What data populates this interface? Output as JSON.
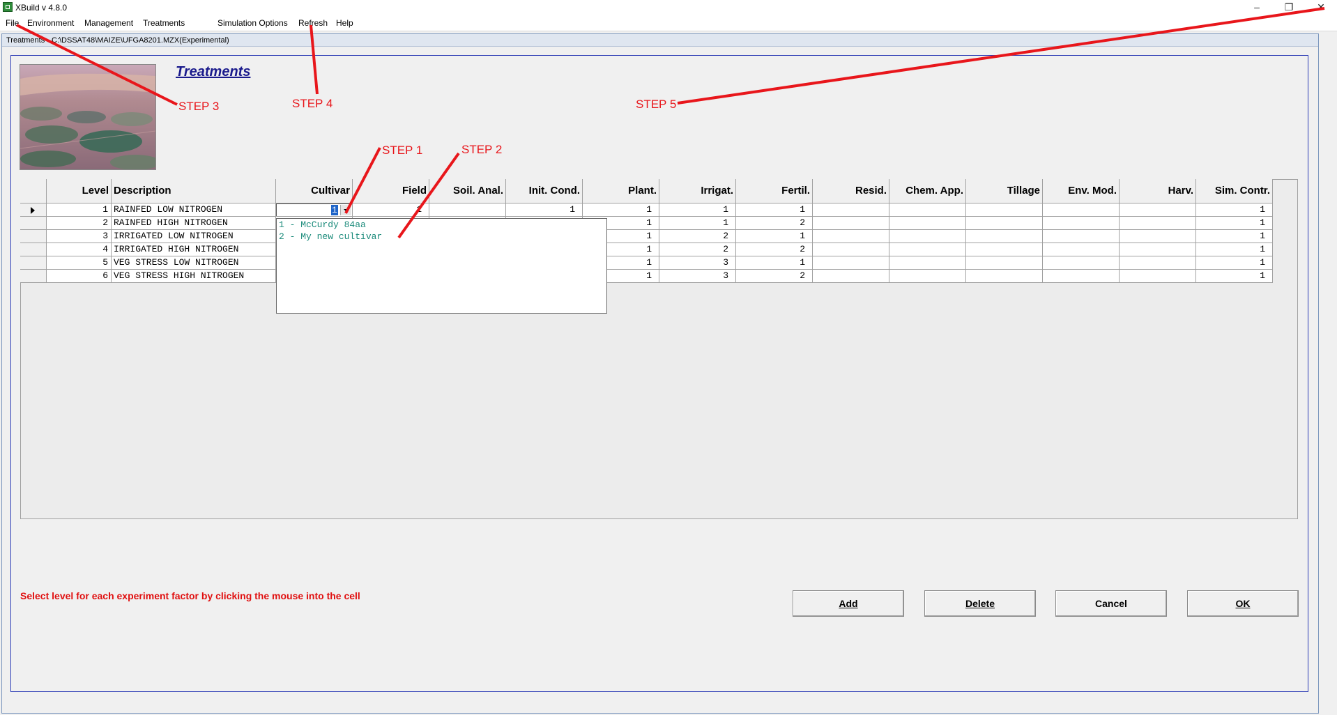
{
  "window": {
    "title": "XBuild v 4.8.0"
  },
  "menu": [
    "File",
    "Environment",
    "Management",
    "Treatments",
    "Simulation Options",
    "Refresh",
    "Help"
  ],
  "child_window": {
    "caption": "Treatments - C:\\DSSAT48\\MAIZE\\UFGA8201.MZX(Experimental)"
  },
  "form": {
    "title": "Treatments"
  },
  "grid": {
    "columns": [
      "Level",
      "Description",
      "Cultivar",
      "Field",
      "Soil. Anal.",
      "Init. Cond.",
      "Plant.",
      "Irrigat.",
      "Fertil.",
      "Resid.",
      "Chem. App.",
      "Tillage",
      "Env. Mod.",
      "Harv.",
      "Sim. Contr."
    ],
    "rows": [
      {
        "level": "1",
        "description": "RAINFED LOW NITROGEN",
        "cultivar": "1",
        "field": "1",
        "soil": "",
        "init": "1",
        "plant": "1",
        "irrig": "1",
        "fertil": "1",
        "resid": "",
        "chem": "",
        "tillage": "",
        "envmod": "",
        "harv": "",
        "simcontr": "1"
      },
      {
        "level": "2",
        "description": "RAINFED HIGH NITROGEN",
        "cultivar": "",
        "field": "",
        "soil": "",
        "init": "",
        "plant": "1",
        "irrig": "1",
        "fertil": "2",
        "resid": "",
        "chem": "",
        "tillage": "",
        "envmod": "",
        "harv": "",
        "simcontr": "1"
      },
      {
        "level": "3",
        "description": "IRRIGATED LOW NITROGEN",
        "cultivar": "",
        "field": "",
        "soil": "",
        "init": "",
        "plant": "1",
        "irrig": "2",
        "fertil": "1",
        "resid": "",
        "chem": "",
        "tillage": "",
        "envmod": "",
        "harv": "",
        "simcontr": "1"
      },
      {
        "level": "4",
        "description": "IRRIGATED HIGH NITROGEN",
        "cultivar": "",
        "field": "",
        "soil": "",
        "init": "",
        "plant": "1",
        "irrig": "2",
        "fertil": "2",
        "resid": "",
        "chem": "",
        "tillage": "",
        "envmod": "",
        "harv": "",
        "simcontr": "1"
      },
      {
        "level": "5",
        "description": "VEG STRESS LOW NITROGEN",
        "cultivar": "",
        "field": "",
        "soil": "",
        "init": "",
        "plant": "1",
        "irrig": "3",
        "fertil": "1",
        "resid": "",
        "chem": "",
        "tillage": "",
        "envmod": "",
        "harv": "",
        "simcontr": "1"
      },
      {
        "level": "6",
        "description": "VEG STRESS HIGH NITROGEN",
        "cultivar": "",
        "field": "",
        "soil": "",
        "init": "",
        "plant": "1",
        "irrig": "3",
        "fertil": "2",
        "resid": "",
        "chem": "",
        "tillage": "",
        "envmod": "",
        "harv": "",
        "simcontr": "1"
      }
    ],
    "cultivar_editor_value": "1",
    "cultivar_options": [
      "1 - McCurdy 84aa",
      "2 - My new cultivar"
    ]
  },
  "hint": "Select level for each experiment factor by clicking the mouse into the cell",
  "buttons": {
    "add": "Add",
    "delete": "Delete",
    "cancel": "Cancel",
    "ok": "OK"
  },
  "annotations": [
    "STEP 1",
    "STEP 2",
    "STEP 3",
    "STEP 4",
    "STEP 5"
  ],
  "colors": {
    "annotation": "#e8161b",
    "selection": "#1e64c8",
    "frame": "#2b3bb5",
    "hint": "#e01010"
  },
  "icons": [
    "xbuild-app-icon",
    "minimize-icon",
    "restore-icon",
    "close-icon",
    "row-pointer-icon",
    "dropdown-arrow-icon"
  ]
}
